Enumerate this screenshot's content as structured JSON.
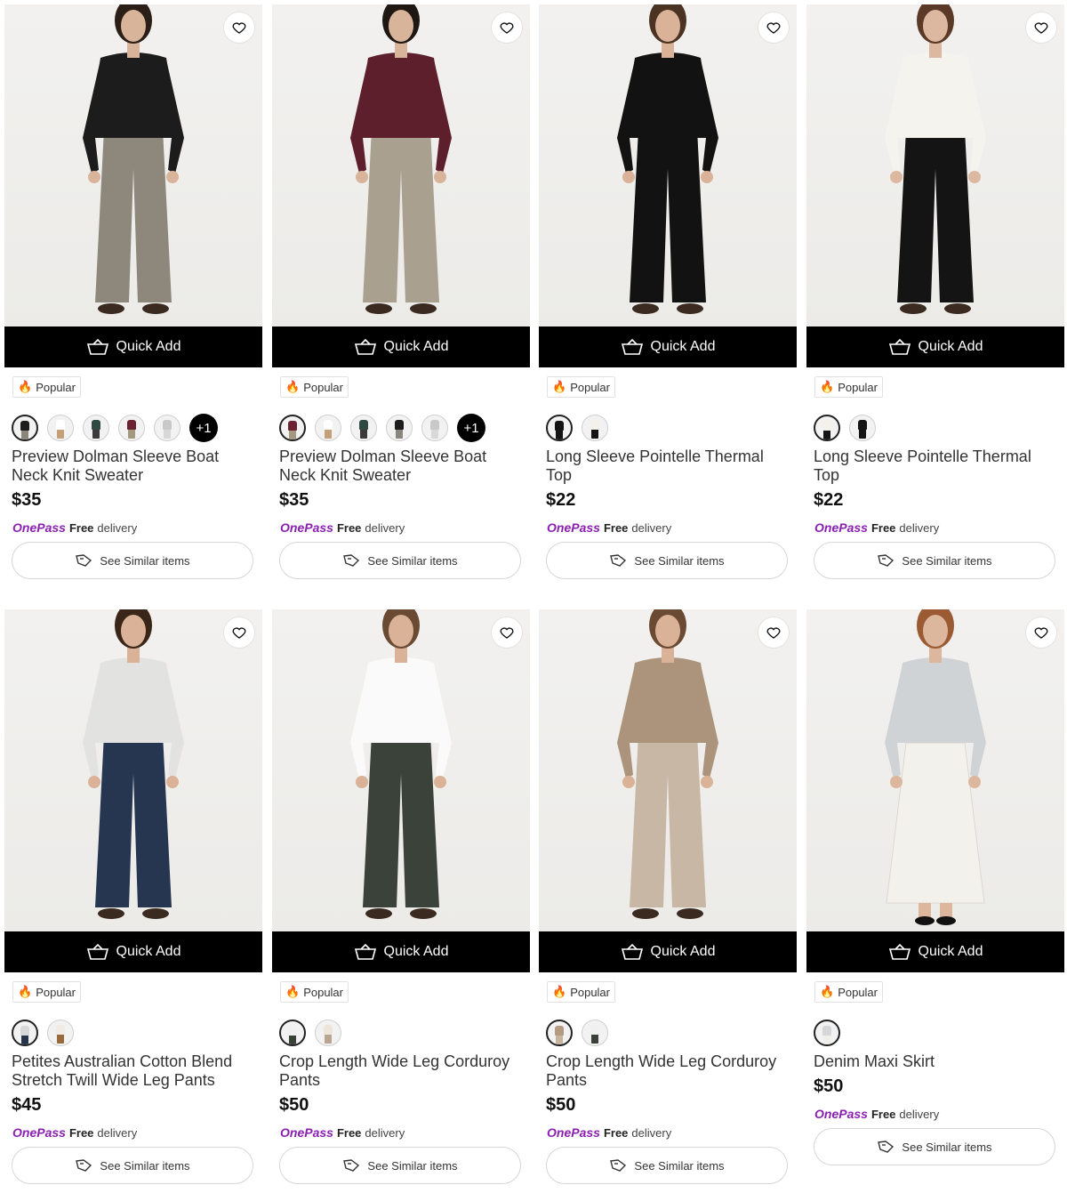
{
  "common": {
    "quick_add_label": "Quick Add",
    "popular_label": "Popular",
    "onepass_label": "OnePass",
    "free_label": "Free",
    "delivery_label": "delivery",
    "similar_label": "See Similar items"
  },
  "products": [
    {
      "title": "Preview Dolman Sleeve Boat Neck Knit Sweater",
      "price": "$35",
      "more": "+1",
      "swatches": [
        {
          "top": "#1d1d1d",
          "bottom": "#8b867c"
        },
        {
          "top": "#ffffff",
          "bottom": "#c4a079"
        },
        {
          "top": "#2f4a42",
          "bottom": "#3b3b3b"
        },
        {
          "top": "#6b2333",
          "bottom": "#a59881"
        },
        {
          "top": "#c9c9c9",
          "bottom": "#d8d8d8"
        }
      ],
      "model": {
        "top": "#1c1c1c",
        "bottom": "#8d877c",
        "skin": "#d8b49a",
        "hair": "#2a1e17"
      }
    },
    {
      "title": "Preview Dolman Sleeve Boat Neck Knit Sweater",
      "price": "$35",
      "more": "+1",
      "swatches": [
        {
          "top": "#6b2333",
          "bottom": "#a59881"
        },
        {
          "top": "#ffffff",
          "bottom": "#c4a079"
        },
        {
          "top": "#2f4a42",
          "bottom": "#3b3b3b"
        },
        {
          "top": "#1d1d1d",
          "bottom": "#8b867c"
        },
        {
          "top": "#c9c9c9",
          "bottom": "#d8d8d8"
        }
      ],
      "model": {
        "top": "#5e1f2c",
        "bottom": "#a9a08f",
        "skin": "#d8b49a",
        "hair": "#1e1712"
      }
    },
    {
      "title": "Long Sleeve Pointelle Thermal Top",
      "price": "$22",
      "more": "",
      "swatches": [
        {
          "top": "#141414",
          "bottom": "#141414"
        },
        {
          "top": "#f4f1ea",
          "bottom": "#141414"
        }
      ],
      "model": {
        "top": "#121212",
        "bottom": "#121212",
        "skin": "#d9b298",
        "hair": "#4a3323"
      }
    },
    {
      "title": "Long Sleeve Pointelle Thermal Top",
      "price": "$22",
      "more": "",
      "swatches": [
        {
          "top": "#f4f1ea",
          "bottom": "#141414"
        },
        {
          "top": "#141414",
          "bottom": "#141414"
        }
      ],
      "model": {
        "top": "#f5f3ee",
        "bottom": "#141414",
        "skin": "#ddb8a0",
        "hair": "#5a3a26"
      }
    },
    {
      "title": "Petites Australian Cotton Blend Stretch Twill Wide Leg Pants",
      "price": "$45",
      "more": "",
      "swatches": [
        {
          "top": "#d8d8d8",
          "bottom": "#25344a"
        },
        {
          "top": "#f0ebe4",
          "bottom": "#9a6a3f"
        }
      ],
      "model": {
        "top": "#e2e2e0",
        "bottom": "#263650",
        "skin": "#d9b298",
        "hair": "#3a2619"
      }
    },
    {
      "title": "Crop Length Wide Leg Corduroy Pants",
      "price": "$50",
      "more": "",
      "swatches": [
        {
          "top": "#f0f0f0",
          "bottom": "#3a4139"
        },
        {
          "top": "#efe6da",
          "bottom": "#b9a590"
        }
      ],
      "model": {
        "top": "#fafafa",
        "bottom": "#3a423a",
        "skin": "#d9b298",
        "hair": "#6b4a33"
      }
    },
    {
      "title": "Crop Length Wide Leg Corduroy Pants",
      "price": "$50",
      "more": "",
      "swatches": [
        {
          "top": "#b39a82",
          "bottom": "#c6b49f"
        },
        {
          "top": "#f0f0f0",
          "bottom": "#3a4139"
        }
      ],
      "model": {
        "top": "#ac947c",
        "bottom": "#c7b7a4",
        "skin": "#d9b298",
        "hair": "#6b4a33"
      }
    },
    {
      "title": "Denim Maxi Skirt",
      "price": "$50",
      "more": "",
      "swatches": [
        {
          "top": "#d4d6d8",
          "bottom": "#f1eee8"
        }
      ],
      "model": {
        "top": "#cfd3d6",
        "bottom": "#f3f1ec",
        "skin": "#dcb79d",
        "hair": "#9a5a33"
      }
    }
  ]
}
